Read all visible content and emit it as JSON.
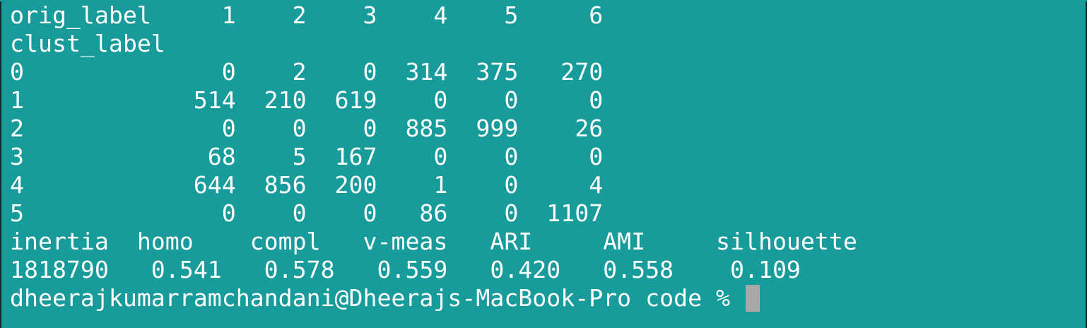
{
  "terminal": {
    "lines": [
      "orig_label     1    2    3    4    5     6",
      "clust_label",
      "0              0    2    0  314  375   270",
      "1            514  210  619    0    0     0",
      "2              0    0    0  885  999    26",
      "3             68    5  167    0    0     0",
      "4            644  856  200    1    0     4",
      "5              0    0    0   86    0  1107",
      "inertia  homo    compl   v-meas   ARI     AMI     silhouette",
      "1818790   0.541   0.578   0.559   0.420   0.558    0.109"
    ],
    "prompt": "dheerajkumarramchandani@Dheerajs-MacBook-Pro code % ",
    "colors": {
      "background": "#179b9b",
      "foreground": "#ffffff",
      "cursor": "#a8a8a8"
    }
  }
}
